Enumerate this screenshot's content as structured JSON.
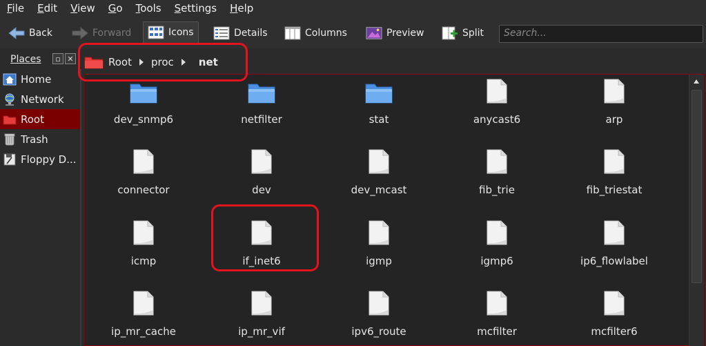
{
  "menu": [
    "File",
    "Edit",
    "View",
    "Go",
    "Tools",
    "Settings",
    "Help"
  ],
  "menu_underline": [
    "F",
    "E",
    "V",
    "G",
    "T",
    "S",
    "H"
  ],
  "toolbar": {
    "back": "Back",
    "forward": "Forward",
    "icons": "Icons",
    "details": "Details",
    "columns": "Columns",
    "preview": "Preview",
    "split": "Split"
  },
  "search": {
    "placeholder": "Search..."
  },
  "places": {
    "title": "Places",
    "items": [
      {
        "label": "Home",
        "icon": "home-icon"
      },
      {
        "label": "Network",
        "icon": "network-icon"
      },
      {
        "label": "Root",
        "icon": "root-folder-icon",
        "selected": true
      },
      {
        "label": "Trash",
        "icon": "trash-icon"
      },
      {
        "label": "Floppy D...",
        "icon": "floppy-icon"
      }
    ]
  },
  "breadcrumb": {
    "root": "Root",
    "proc": "proc",
    "current": "net"
  },
  "files": [
    {
      "name": "dev_snmp6",
      "type": "folder"
    },
    {
      "name": "netfilter",
      "type": "folder"
    },
    {
      "name": "stat",
      "type": "folder"
    },
    {
      "name": "anycast6",
      "type": "file"
    },
    {
      "name": "arp",
      "type": "file"
    },
    {
      "name": "connector",
      "type": "file"
    },
    {
      "name": "dev",
      "type": "file"
    },
    {
      "name": "dev_mcast",
      "type": "file"
    },
    {
      "name": "fib_trie",
      "type": "file"
    },
    {
      "name": "fib_triestat",
      "type": "file"
    },
    {
      "name": "icmp",
      "type": "file"
    },
    {
      "name": "if_inet6",
      "type": "file"
    },
    {
      "name": "igmp",
      "type": "file"
    },
    {
      "name": "igmp6",
      "type": "file"
    },
    {
      "name": "ip6_flowlabel",
      "type": "file"
    },
    {
      "name": "ip_mr_cache",
      "type": "file"
    },
    {
      "name": "ip_mr_vif",
      "type": "file"
    },
    {
      "name": "ipv6_route",
      "type": "file"
    },
    {
      "name": "mcfilter",
      "type": "file"
    },
    {
      "name": "mcfilter6",
      "type": "file"
    }
  ],
  "colors": {
    "accent": "#7a0000",
    "annotation": "#e3141d",
    "folder": "#5aa0e6"
  }
}
